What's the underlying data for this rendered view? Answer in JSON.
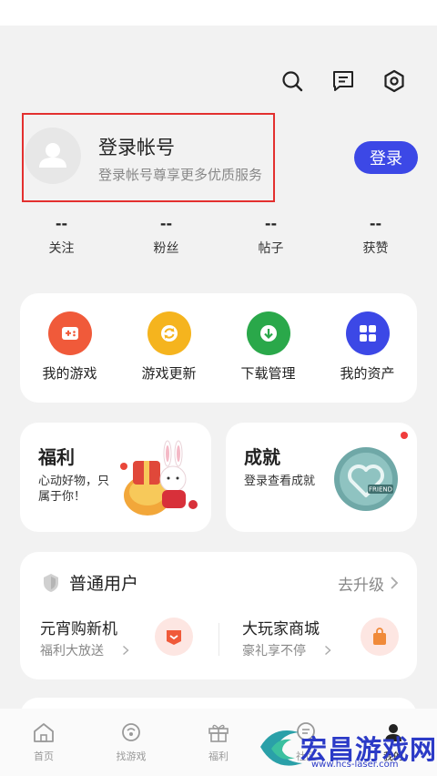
{
  "header": {
    "icons": [
      "search-icon",
      "message-icon",
      "settings-icon"
    ]
  },
  "profile": {
    "title": "登录帐号",
    "subtitle": "登录帐号尊享更多优质服务",
    "login_button": "登录"
  },
  "stats": [
    {
      "value": "--",
      "label": "关注"
    },
    {
      "value": "--",
      "label": "粉丝"
    },
    {
      "value": "--",
      "label": "帖子"
    },
    {
      "value": "--",
      "label": "获赞"
    }
  ],
  "quick_actions": [
    {
      "label": "我的游戏",
      "icon": "gamepad-icon",
      "color": "#f05a3a"
    },
    {
      "label": "游戏更新",
      "icon": "refresh-icon",
      "color": "#f5b41e"
    },
    {
      "label": "下载管理",
      "icon": "download-icon",
      "color": "#2aa84a"
    },
    {
      "label": "我的资产",
      "icon": "grid-icon",
      "color": "#3c48e6"
    }
  ],
  "fuli_card": {
    "title": "福利",
    "desc": "心动好物，只属于你！"
  },
  "chengjiu_card": {
    "title": "成就",
    "desc": "登录查看成就",
    "badge_text": "FRIEND"
  },
  "member": {
    "title": "普通用户",
    "upgrade": "去升级",
    "promos": [
      {
        "title": "元宵购新机",
        "sub": "福利大放送"
      },
      {
        "title": "大玩家商城",
        "sub": "豪礼享不停"
      }
    ]
  },
  "tabbar": [
    {
      "label": "首页",
      "icon": "home-icon"
    },
    {
      "label": "找游戏",
      "icon": "find-game-icon"
    },
    {
      "label": "福利",
      "icon": "gift-icon"
    },
    {
      "label": "社区",
      "icon": "community-icon"
    },
    {
      "label": "我的",
      "icon": "profile-icon"
    }
  ],
  "watermark": {
    "text": "宏昌游戏网",
    "url": "www.hcs-laser.com"
  },
  "colors": {
    "accent": "#3c48e6",
    "highlight_border": "#e3302f"
  }
}
